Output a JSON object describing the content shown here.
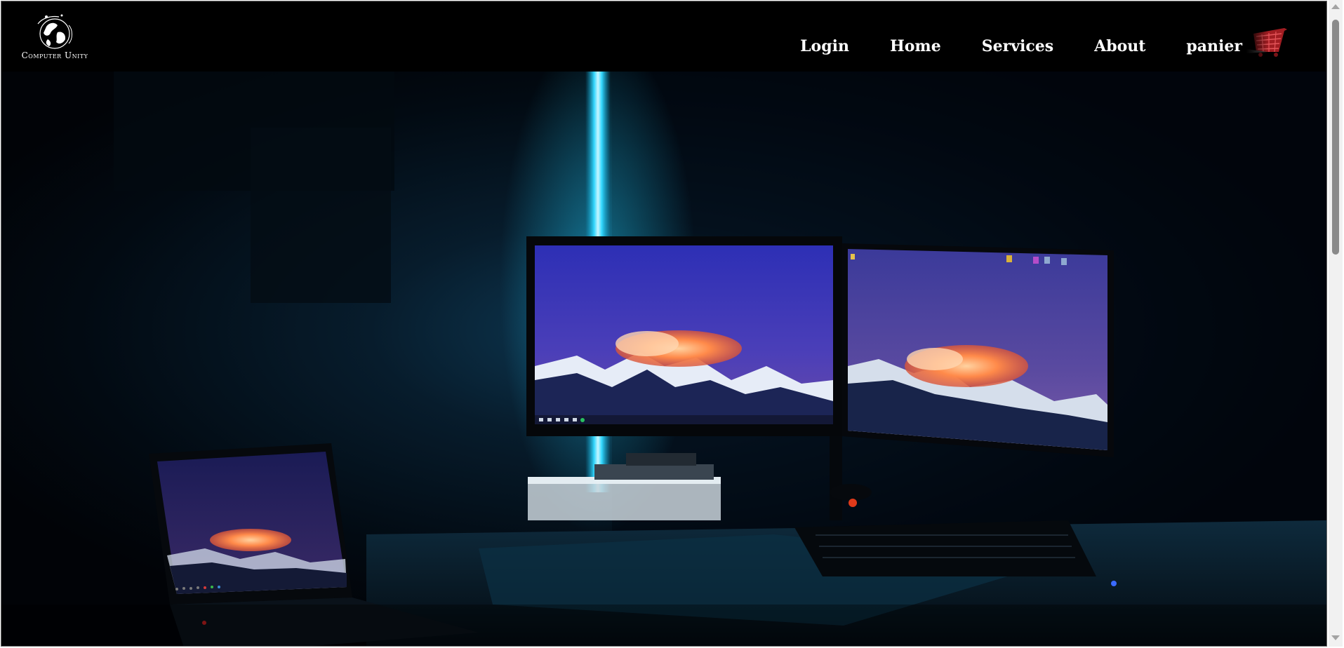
{
  "brand": {
    "name": "Computer Unity"
  },
  "nav": {
    "items": [
      "Login",
      "Home",
      "Services",
      "About"
    ],
    "cart_label": "panier"
  },
  "colors": {
    "background": "#000000",
    "nav_text": "#ffffff",
    "neon_light": "#2fd6ff",
    "cart_icon": "#c0262a"
  },
  "icons": {
    "logo": "globe-logo-icon",
    "cart": "cart-icon"
  }
}
